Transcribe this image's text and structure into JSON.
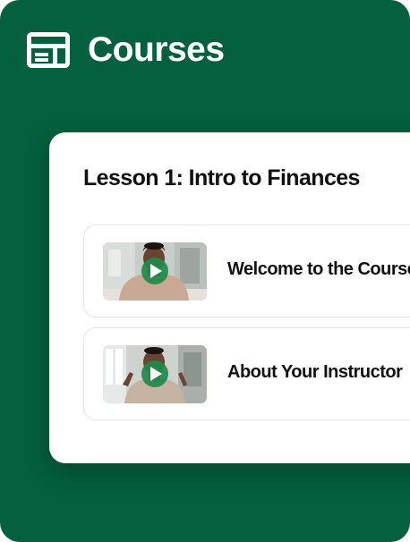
{
  "header": {
    "title": "Courses",
    "icon": "layout-panel-icon"
  },
  "lesson": {
    "title": "Lesson 1: Intro to Finances",
    "videos": [
      {
        "title": "Welcome to the Course",
        "thumbnail": "instructor-seated-video-thumbnail",
        "play_icon": "play-icon"
      },
      {
        "title": "About Your Instructor",
        "thumbnail": "instructor-gesturing-video-thumbnail",
        "play_icon": "play-icon"
      }
    ]
  },
  "colors": {
    "background": "#04603f",
    "card": "#ffffff",
    "play_button": "#1f8a4a",
    "text": "#111111"
  }
}
